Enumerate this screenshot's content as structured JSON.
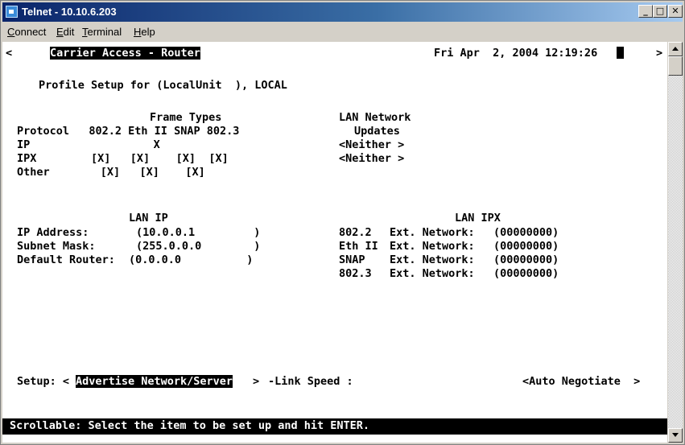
{
  "window": {
    "title": "Telnet - 10.10.6.203",
    "controls": {
      "minimize": "_",
      "maximize": "□",
      "close": "✕"
    }
  },
  "menu": {
    "items": [
      {
        "label": "Connect",
        "hotkey": "C",
        "rest": "onnect"
      },
      {
        "label": "Edit",
        "hotkey": "E",
        "rest": "dit"
      },
      {
        "label": "Terminal",
        "hotkey": "T",
        "rest": "erminal"
      },
      {
        "label": "Help",
        "hotkey": "H",
        "rest": "elp"
      }
    ]
  },
  "terminal": {
    "left_arrow": "<",
    "app_name": "Carrier Access - Router",
    "datetime": "Fri Apr  2, 2004 12:19:26",
    "right_arrow": ">",
    "profile_line": "Profile Setup for (LocalUnit  ), LOCAL",
    "frame_types_header": "Frame Types",
    "lan_network_header": "LAN Network",
    "columns_line": "Protocol   802.2 Eth II SNAP 802.3",
    "updates_header": "Updates",
    "rows": [
      {
        "protocol": "IP",
        "cells": "             X",
        "update": "<Neither >"
      },
      {
        "protocol": "IPX",
        "cells": "        [X]   [X]    [X]  [X]",
        "update": "<Neither >"
      },
      {
        "protocol": "Other",
        "cells": "      [X]   [X]    [X]",
        "update": ""
      }
    ],
    "lan_ip_header": "LAN IP",
    "lan_ipx_header": "LAN IPX",
    "ip_rows": [
      {
        "label": "IP Address:",
        "value": "(10.0.0.1         )"
      },
      {
        "label": "Subnet Mask:",
        "value": "(255.0.0.0        )"
      },
      {
        "label": "Default Router:",
        "value": "(0.0.0.0          )"
      }
    ],
    "ipx_rows": [
      {
        "frame": "802.2 ",
        "label": "Ext. Network:",
        "value": "(00000000)"
      },
      {
        "frame": "Eth II",
        "label": "Ext. Network:",
        "value": "(00000000)"
      },
      {
        "frame": "SNAP  ",
        "label": "Ext. Network:",
        "value": "(00000000)"
      },
      {
        "frame": "802.3 ",
        "label": "Ext. Network:",
        "value": "(00000000)"
      }
    ],
    "setup_label": "Setup: <",
    "setup_value": "Advertise Network/Server",
    "setup_close": ">",
    "link_speed_label": "-Link Speed :",
    "link_speed_value": "<Auto Negotiate  >",
    "status_line": "Scrollable: Select the item to be set up and hit ENTER."
  }
}
